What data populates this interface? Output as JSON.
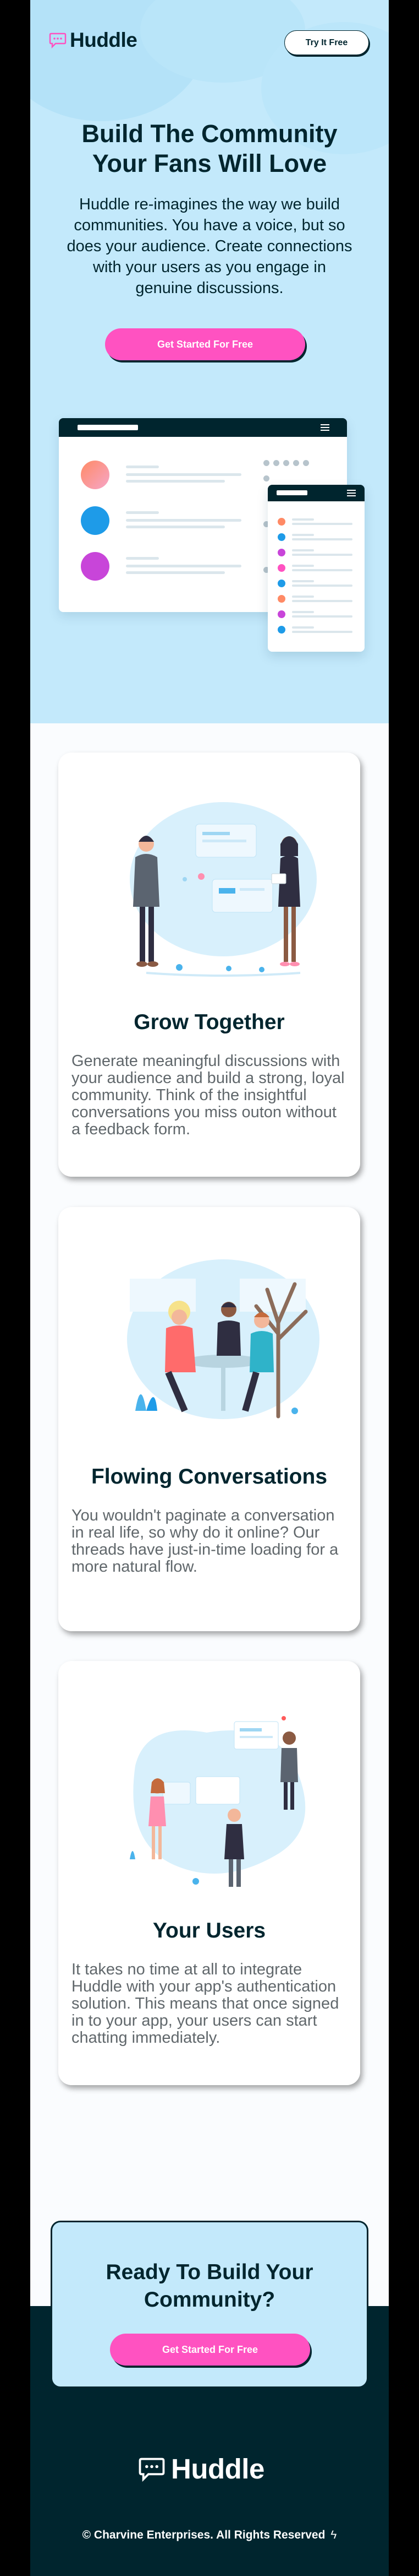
{
  "brand": {
    "name": "Huddle",
    "logo_icon": "chat-bubble-icon",
    "accent": "#ff52c1",
    "dark": "#00252e",
    "light_blue": "#c3e9fb"
  },
  "header": {
    "try_label": "Try It Free"
  },
  "hero": {
    "title": "Build The Community Your Fans Will Love",
    "text": "Huddle re-imagines the way we build communities. You have a voice, but so does your audience. Create connections with your users as you engage in genuine discussions.",
    "cta_label": "Get Started For Free"
  },
  "features": [
    {
      "title": "Grow Together",
      "text": "Generate meaningful discussions with your audience and build a strong, loyal community. Think of the insightful conversations you miss outon without a feedback form.",
      "illustration": "people-chatting-illustration"
    },
    {
      "title": "Flowing Conversations",
      "text": "You wouldn't paginate a conversation in real life, so why do it online? Our threads have just-in-time loading for a more natural flow.",
      "illustration": "group-at-table-illustration"
    },
    {
      "title": "Your Users",
      "text": "It takes no time at all to integrate Huddle with your app's authentication solution. This means that once signed in to your app, your users can start chatting immediately.",
      "illustration": "team-presentation-illustration"
    }
  ],
  "cta_section": {
    "title": "Ready To Build Your Community?",
    "cta_label": "Get Started For Free"
  },
  "footer": {
    "copyright": "© Charvine Enterprises. All Rights Reserved",
    "logo_text": "Huddle",
    "bolt_icon": "lightning-icon"
  }
}
